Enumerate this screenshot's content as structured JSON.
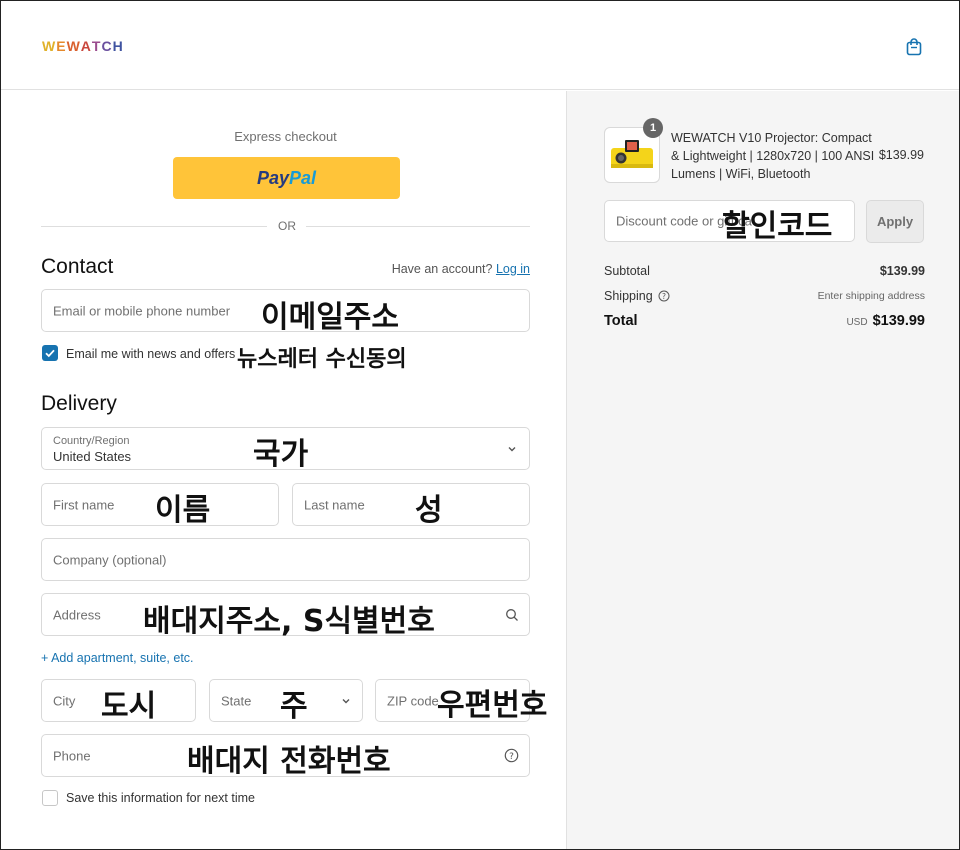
{
  "header": {
    "logo_letters": [
      "W",
      "E",
      "W",
      "A",
      "T",
      "C",
      "H"
    ],
    "logo_colors": [
      "#e0b12a",
      "#e58a2c",
      "#d9612f",
      "#c9473d",
      "#9a4c8e",
      "#6a4f9e",
      "#3f53a0"
    ],
    "cart_icon": "shopping-bag-icon"
  },
  "express": {
    "label": "Express checkout",
    "paypal_a": "Pay",
    "paypal_b": "Pal",
    "or": "OR"
  },
  "contact": {
    "title": "Contact",
    "have_account": "Have an account?",
    "login": "Log in",
    "email_placeholder": "Email or mobile phone number",
    "email_annotation": "이메일주소",
    "news_label": "Email me with news and offers",
    "news_annotation": "뉴스레터 수신동의",
    "news_checked": true
  },
  "delivery": {
    "title": "Delivery",
    "country_label": "Country/Region",
    "country_value": "United States",
    "country_annotation": "국가",
    "first_name": "First name",
    "first_annotation": "이름",
    "last_name": "Last name",
    "last_annotation": "성",
    "company": "Company (optional)",
    "address": "Address",
    "address_annotation": "배대지주소, S식별번호",
    "add_apt": "+ Add apartment, suite, etc.",
    "city": "City",
    "city_annotation": "도시",
    "state": "State",
    "state_annotation": "주",
    "zip": "ZIP code",
    "zip_annotation": "우편번호",
    "phone": "Phone",
    "phone_annotation": "배대지 전화번호",
    "save_info": "Save this information for next time"
  },
  "order": {
    "qty": "1",
    "product_name": "WEWATCH V10 Projector: Compact & Lightweight | 1280x720 | 100 ANSI Lumens | WiFi, Bluetooth",
    "product_price": "$139.99",
    "discount_placeholder": "Discount code or gift ca",
    "discount_annotation": "할인코드",
    "apply": "Apply",
    "subtotal_label": "Subtotal",
    "subtotal_value": "$139.99",
    "shipping_label": "Shipping",
    "shipping_value": "Enter shipping address",
    "total_label": "Total",
    "currency": "USD",
    "total_value": "$139.99"
  }
}
